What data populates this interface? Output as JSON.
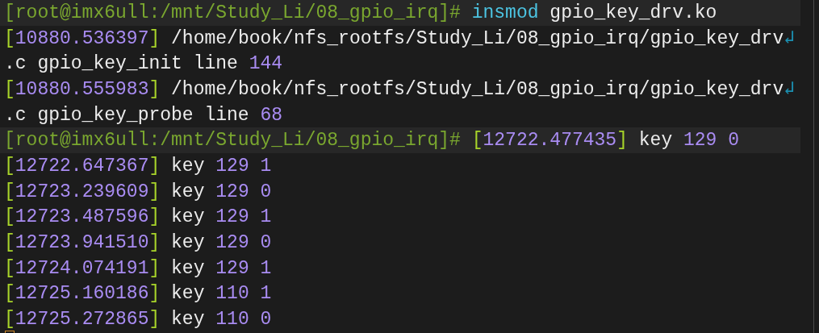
{
  "terminal": {
    "lines": [
      {
        "segments": [
          {
            "kind": "prompt",
            "text": "[root@imx6ull:/mnt/Study_Li/08_gpio_irq]# "
          },
          {
            "kind": "command",
            "text": "insmod"
          },
          {
            "kind": "text",
            "text": " gpio_key_drv.ko"
          }
        ]
      },
      {
        "segments": [
          {
            "kind": "bracket",
            "text": "["
          },
          {
            "kind": "number",
            "text": "10880.536397"
          },
          {
            "kind": "bracket",
            "text": "]"
          },
          {
            "kind": "text",
            "text": " /home/book/nfs_rootfs/Study_Li/08_gpio_irq/gpio_key_drv"
          },
          {
            "kind": "wrap",
            "text": "↲"
          }
        ]
      },
      {
        "segments": [
          {
            "kind": "text",
            "text": ".c gpio_key_init line "
          },
          {
            "kind": "number",
            "text": "144"
          }
        ]
      },
      {
        "segments": [
          {
            "kind": "bracket",
            "text": "["
          },
          {
            "kind": "number",
            "text": "10880.555983"
          },
          {
            "kind": "bracket",
            "text": "]"
          },
          {
            "kind": "text",
            "text": " /home/book/nfs_rootfs/Study_Li/08_gpio_irq/gpio_key_drv"
          },
          {
            "kind": "wrap",
            "text": "↲"
          }
        ]
      },
      {
        "segments": [
          {
            "kind": "text",
            "text": ".c gpio_key_probe line "
          },
          {
            "kind": "number",
            "text": "68"
          }
        ]
      },
      {
        "segments": [
          {
            "kind": "prompt",
            "text": "[root@imx6ull:/mnt/Study_Li/08_gpio_irq]# "
          },
          {
            "kind": "bracket",
            "text": "["
          },
          {
            "kind": "number",
            "text": "12722.477435"
          },
          {
            "kind": "bracket",
            "text": "]"
          },
          {
            "kind": "text",
            "text": " key "
          },
          {
            "kind": "number",
            "text": "129 0"
          }
        ]
      },
      {
        "segments": [
          {
            "kind": "bracket",
            "text": "["
          },
          {
            "kind": "number",
            "text": "12722.647367"
          },
          {
            "kind": "bracket",
            "text": "]"
          },
          {
            "kind": "text",
            "text": " key "
          },
          {
            "kind": "number",
            "text": "129 1"
          }
        ]
      },
      {
        "segments": [
          {
            "kind": "bracket",
            "text": "["
          },
          {
            "kind": "number",
            "text": "12723.239609"
          },
          {
            "kind": "bracket",
            "text": "]"
          },
          {
            "kind": "text",
            "text": " key "
          },
          {
            "kind": "number",
            "text": "129 0"
          }
        ]
      },
      {
        "segments": [
          {
            "kind": "bracket",
            "text": "["
          },
          {
            "kind": "number",
            "text": "12723.487596"
          },
          {
            "kind": "bracket",
            "text": "]"
          },
          {
            "kind": "text",
            "text": " key "
          },
          {
            "kind": "number",
            "text": "129 1"
          }
        ]
      },
      {
        "segments": [
          {
            "kind": "bracket",
            "text": "["
          },
          {
            "kind": "number",
            "text": "12723.941510"
          },
          {
            "kind": "bracket",
            "text": "]"
          },
          {
            "kind": "text",
            "text": " key "
          },
          {
            "kind": "number",
            "text": "129 0"
          }
        ]
      },
      {
        "segments": [
          {
            "kind": "bracket",
            "text": "["
          },
          {
            "kind": "number",
            "text": "12724.074191"
          },
          {
            "kind": "bracket",
            "text": "]"
          },
          {
            "kind": "text",
            "text": " key "
          },
          {
            "kind": "number",
            "text": "129 1"
          }
        ]
      },
      {
        "segments": [
          {
            "kind": "bracket",
            "text": "["
          },
          {
            "kind": "number",
            "text": "12725.160186"
          },
          {
            "kind": "bracket",
            "text": "]"
          },
          {
            "kind": "text",
            "text": " key "
          },
          {
            "kind": "number",
            "text": "110 1"
          }
        ]
      },
      {
        "segments": [
          {
            "kind": "bracket",
            "text": "["
          },
          {
            "kind": "number",
            "text": "12725.272865"
          },
          {
            "kind": "bracket",
            "text": "]"
          },
          {
            "kind": "text",
            "text": " key "
          },
          {
            "kind": "number",
            "text": "110 0"
          }
        ]
      }
    ],
    "cursor_visible": true
  }
}
